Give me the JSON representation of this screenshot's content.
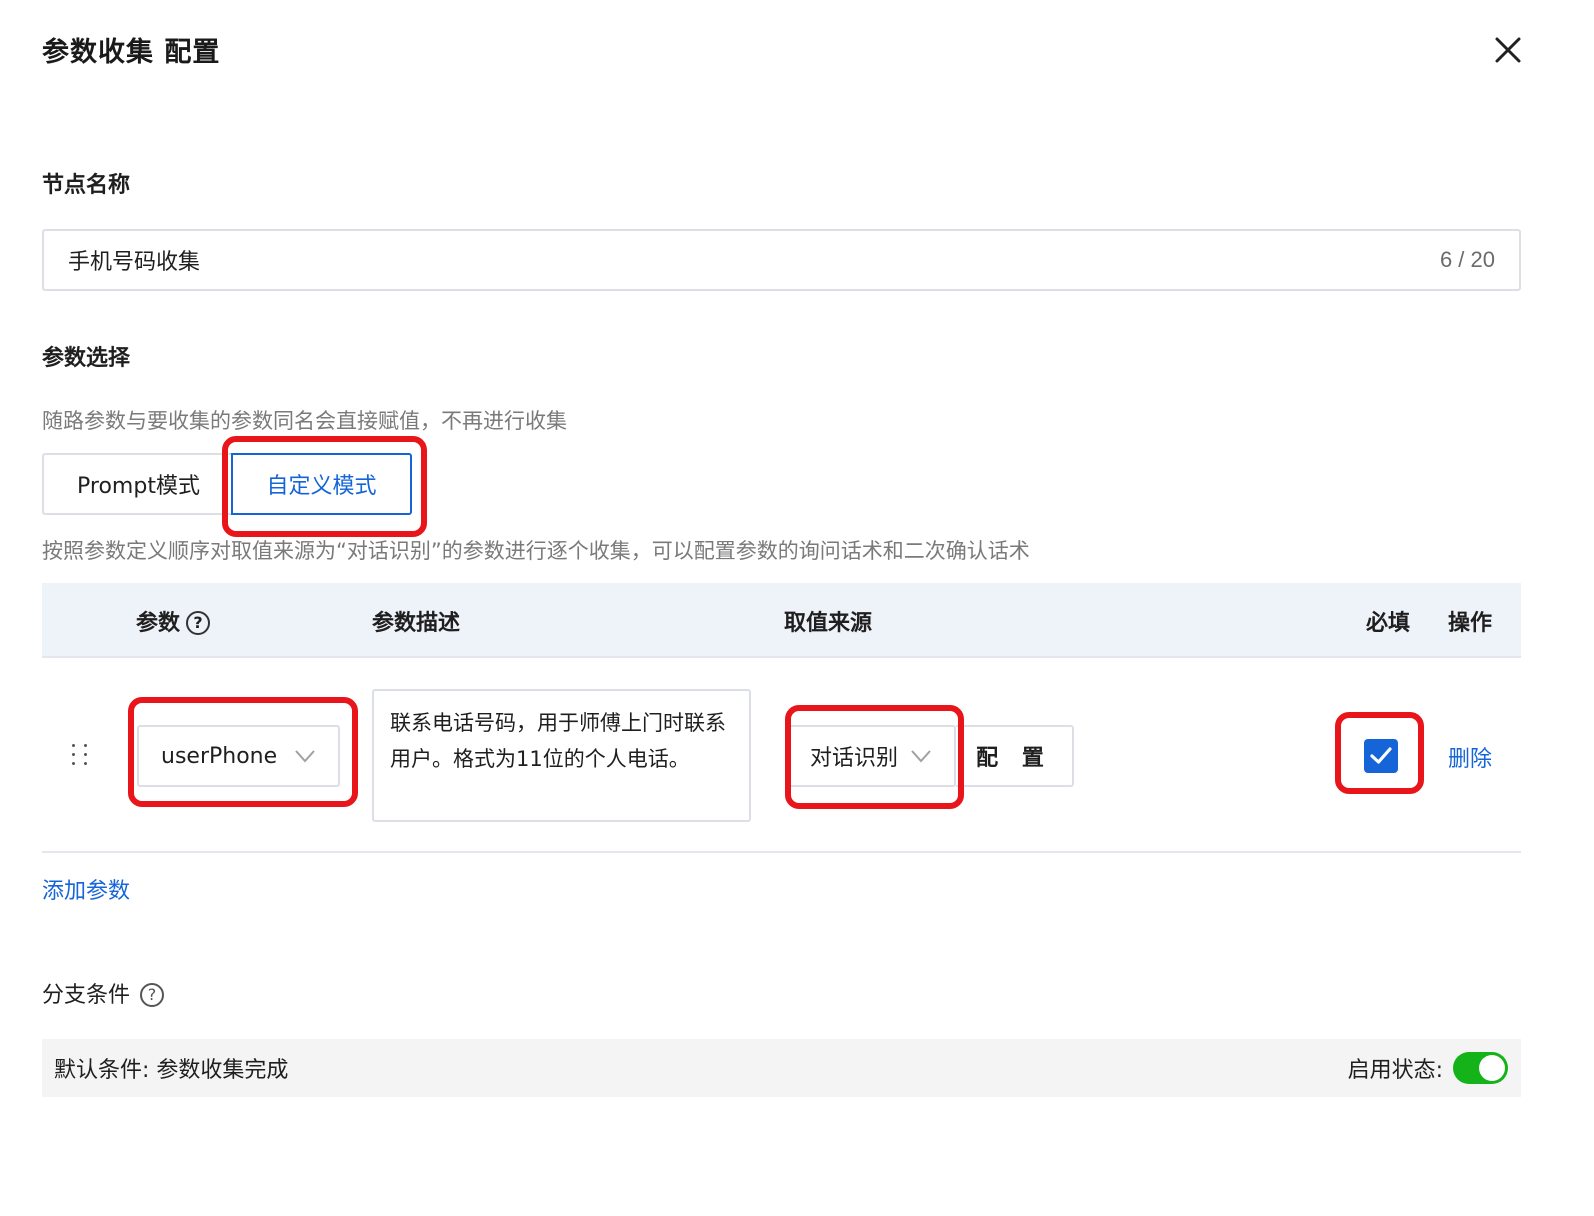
{
  "dialog": {
    "title": "参数收集 配置"
  },
  "node_name": {
    "label": "节点名称",
    "value": "手机号码收集",
    "counter": "6 / 20"
  },
  "param_select": {
    "label": "参数选择",
    "hint": "随路参数与要收集的参数同名会直接赋值，不再进行收集",
    "modes": [
      "Prompt模式",
      "自定义模式"
    ],
    "selected_mode": "自定义模式",
    "mode_hint": "按照参数定义顺序对取值来源为“对话识别”的参数进行逐个收集，可以配置参数的询问话术和二次确认话术"
  },
  "table": {
    "headers": {
      "param": "参数",
      "description": "参数描述",
      "source": "取值来源",
      "required": "必填",
      "action": "操作"
    },
    "rows": [
      {
        "param": "userPhone",
        "description": "联系电话号码，用于师傅上门时联系用户。格式为11位的个人电话。",
        "source": "对话识别",
        "config_label": "配 置",
        "required": true,
        "action_label": "删除"
      }
    ],
    "add_label": "添加参数"
  },
  "branch": {
    "label": "分支条件",
    "default_condition": "默认条件: 参数收集完成",
    "status_label": "启用状态:",
    "enabled": true
  },
  "colors": {
    "primary": "#1565d8",
    "highlight": "#e8161b",
    "toggle_on": "#14b31a",
    "header_bg": "#eef2f9"
  }
}
